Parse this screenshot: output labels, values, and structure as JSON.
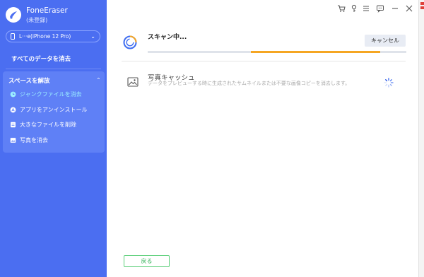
{
  "app": {
    "name": "FoneEraser",
    "registration": "(未登録)"
  },
  "device": {
    "label": "L···e(iPhone 12 Pro)"
  },
  "sidebar": {
    "erase_all": "すべてのデータを消去",
    "free_space": "スペースを解放",
    "items": [
      {
        "label": "ジャンクファイルを消去",
        "active": true
      },
      {
        "label": "アプリをアンインストール",
        "active": false
      },
      {
        "label": "大きなファイルを削除",
        "active": false
      },
      {
        "label": "写真を消去",
        "active": false
      }
    ]
  },
  "scan": {
    "title": "スキャン中...",
    "cancel_label": "キャンセル",
    "progress_start": 0.4,
    "progress_end": 0.9
  },
  "result_item": {
    "title": "写真キャッシュ",
    "description": "データをプレビューする時に生成されたサムネイルまたは不要な画像コピーを消去します。"
  },
  "footer": {
    "back_label": "戻る"
  },
  "colors": {
    "sidebar": "#4b6ef1",
    "accent_orange": "#f5a623",
    "back_green": "#35b25a"
  }
}
